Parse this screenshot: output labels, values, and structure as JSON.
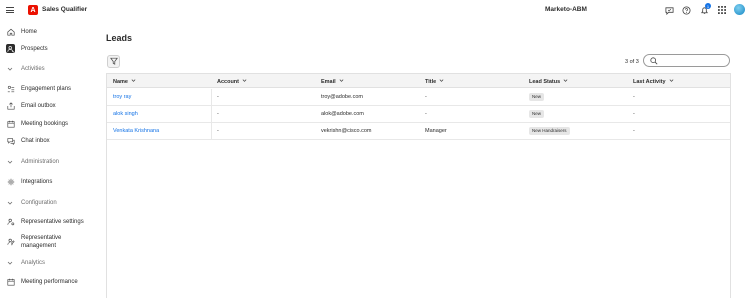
{
  "app": {
    "title": "Sales Qualifier",
    "logo_letter": "A",
    "workspace": "Marketo-ABM",
    "notification_count": "1"
  },
  "sidebar": {
    "items": [
      {
        "label": "Home",
        "icon": "home-icon"
      },
      {
        "label": "Prospects",
        "icon": "prospects-icon"
      }
    ],
    "sections": [
      {
        "title": "Activities",
        "items": [
          {
            "label": "Engagement plans",
            "icon": "engagement-icon"
          },
          {
            "label": "Email outbox",
            "icon": "outbox-icon"
          },
          {
            "label": "Meeting bookings",
            "icon": "calendar-icon"
          },
          {
            "label": "Chat inbox",
            "icon": "chat-icon"
          }
        ]
      },
      {
        "title": "Administration",
        "items": [
          {
            "label": "Integrations",
            "icon": "gear-icon"
          }
        ]
      },
      {
        "title": "Configuration",
        "items": [
          {
            "label": "Representative settings",
            "icon": "user-settings-icon"
          },
          {
            "label": "Representative management",
            "icon": "user-management-icon"
          }
        ]
      },
      {
        "title": "Analytics",
        "items": [
          {
            "label": "Meeting performance",
            "icon": "calendar-icon"
          }
        ]
      }
    ]
  },
  "main": {
    "title": "Leads",
    "count": "3 of 3",
    "search": {
      "placeholder": "",
      "value": ""
    },
    "columns": [
      "Name",
      "Account",
      "Email",
      "Title",
      "Lead Status",
      "Last Activity"
    ],
    "rows": [
      {
        "name": "troy ray",
        "account": "-",
        "email": "troy@adobe.com",
        "title": "-",
        "status": "New",
        "last_activity": "-"
      },
      {
        "name": "alok singh",
        "account": "-",
        "email": "alok@adobe.com",
        "title": "-",
        "status": "New",
        "last_activity": "-"
      },
      {
        "name": "Venkata Krishnana",
        "account": "-",
        "email": "vekrishn@cisco.com",
        "title": "Manager",
        "status": "New Handraisers",
        "last_activity": "-"
      }
    ]
  }
}
